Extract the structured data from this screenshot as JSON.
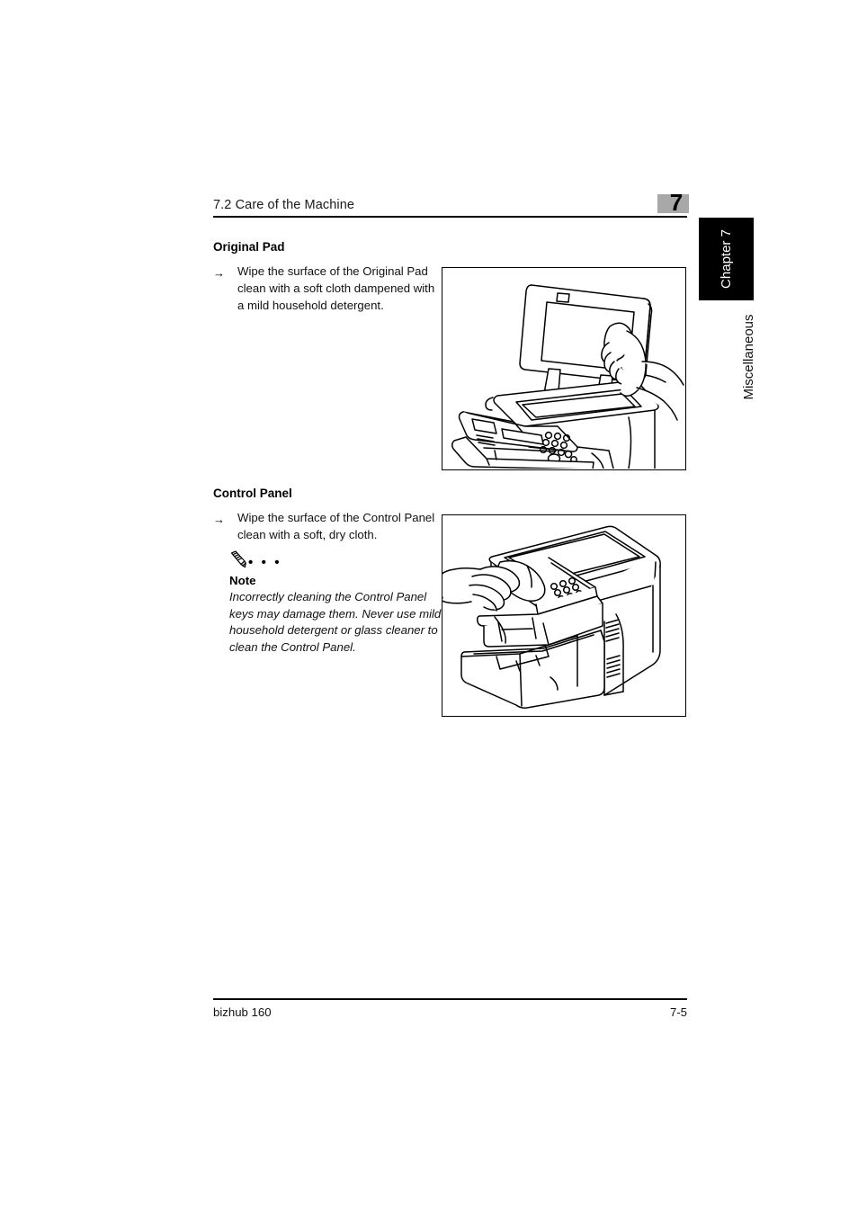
{
  "document": {
    "product": "bizhub 160",
    "page_number": "7-5"
  },
  "header": {
    "section_title": "7.2 Care of the Machine",
    "chapter_number": "7",
    "chapter_tab_label": "Chapter 7",
    "section_tab_label": "Miscellaneous"
  },
  "sections": [
    {
      "heading": "Original Pad",
      "bullet": "→",
      "step_text": "Wipe the surface of the Original Pad clean with a soft cloth dampened with a mild household detergent.",
      "figure_caption": "Copier with document cover raised and a hand wiping the original pad with a cloth"
    },
    {
      "heading": "Control Panel",
      "bullet": "→",
      "step_text": "Wipe the surface of the Control Panel clean with a soft, dry cloth.",
      "figure_caption": "Multifunction printer with a hand wiping the control panel with a cloth"
    }
  ],
  "note": {
    "icon": "pencil-icon",
    "dots": "• • •",
    "title": "Note",
    "body": "Incorrectly cleaning the Control Panel keys may damage them. Never use mild household detergent or glass cleaner to clean the Control Panel."
  },
  "footer": {
    "left": "bizhub 160",
    "right": "7-5"
  },
  "colors": {
    "chapter_box_gray": "#a8a8a8",
    "tab_black": "#000000",
    "text_black": "#111111",
    "page_white": "#ffffff"
  }
}
